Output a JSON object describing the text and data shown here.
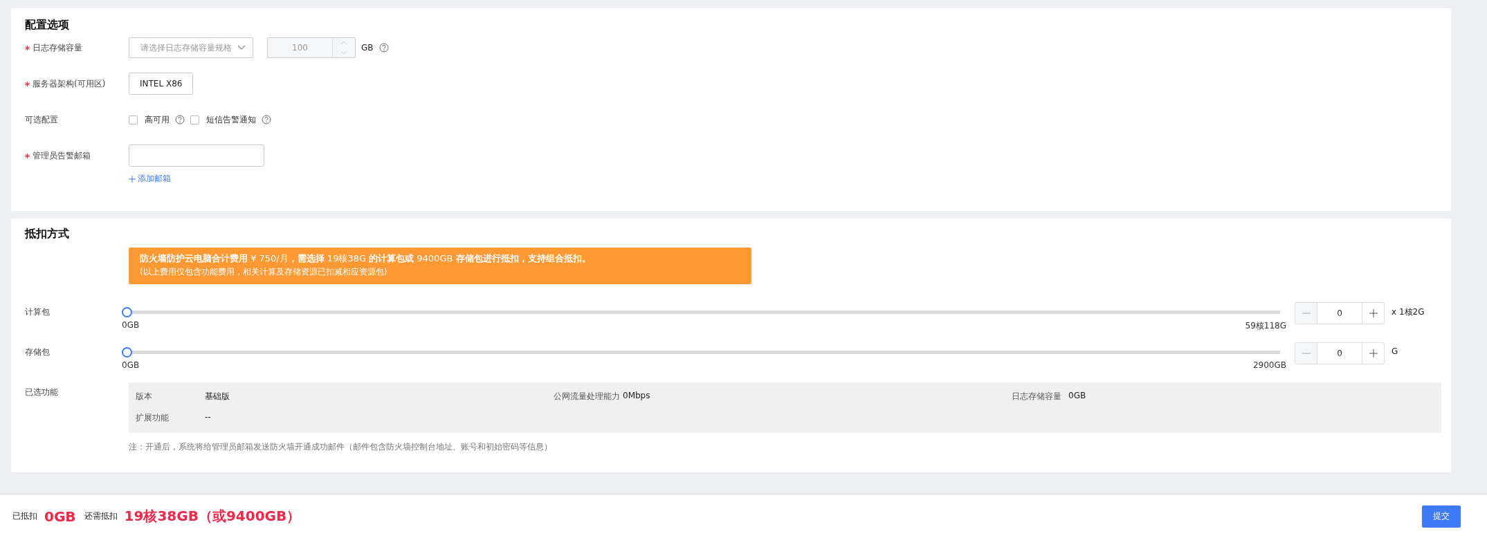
{
  "config": {
    "title": "配置选项",
    "log_capacity": {
      "label": "日志存储容量",
      "required": true,
      "select_placeholder": "请选择日志存储容量规格",
      "value": "100",
      "disabled": true,
      "unit": "GB"
    },
    "arch": {
      "label": "服务器架构(可用区)",
      "required": true,
      "options": [
        {
          "label": "INTEL X86",
          "selected": false
        }
      ]
    },
    "optional": {
      "label": "可选配置",
      "required": false,
      "options": [
        {
          "label": "高可用",
          "checked": false
        },
        {
          "label": "短信告警通知",
          "checked": false
        }
      ]
    },
    "email": {
      "label": "管理员告警邮箱",
      "required": true,
      "add_link": "添加邮箱"
    }
  },
  "deduction": {
    "title": "抵扣方式",
    "notice": [
      "**防火墙防护云电脑合计费用** ¥ 750/月**，需选择** 19核38G **的计算包或** 9400GB **存储包进行抵扣，支持组合抵扣。**",
      "(以上费用仅包含功能费用，相关计算及存储资源已扣减相应资源包)"
    ],
    "packages": [
      {
        "label": "计算包",
        "level": 0,
        "min": "0GB",
        "max": "59核118G",
        "value": "0",
        "unit": "x 1核2G"
      },
      {
        "label": "存储包",
        "level": 0,
        "min": "0GB",
        "max": "2900GB",
        "value": "0",
        "unit": "G"
      }
    ],
    "features": {
      "label": "已选功能",
      "items": [
        {
          "label": "版本",
          "value": "基础版"
        },
        {
          "label": "公网流量处理能力",
          "value": "0Mbps"
        },
        {
          "label": "日志存储容量",
          "value": "0GB"
        },
        {
          "label": "扩展功能",
          "value": "--"
        }
      ]
    },
    "note": "注：开通后，系统将给管理员邮箱发送防火墙开通成功邮件（邮件包含防火墙控制台地址、账号和初始密码等信息）"
  },
  "footer": {
    "deducted_label": "已抵扣",
    "deducted": "0GB",
    "remaining_label": "还需抵扣",
    "remaining": "19核38GB（或9400GB）",
    "submit": "提交"
  }
}
